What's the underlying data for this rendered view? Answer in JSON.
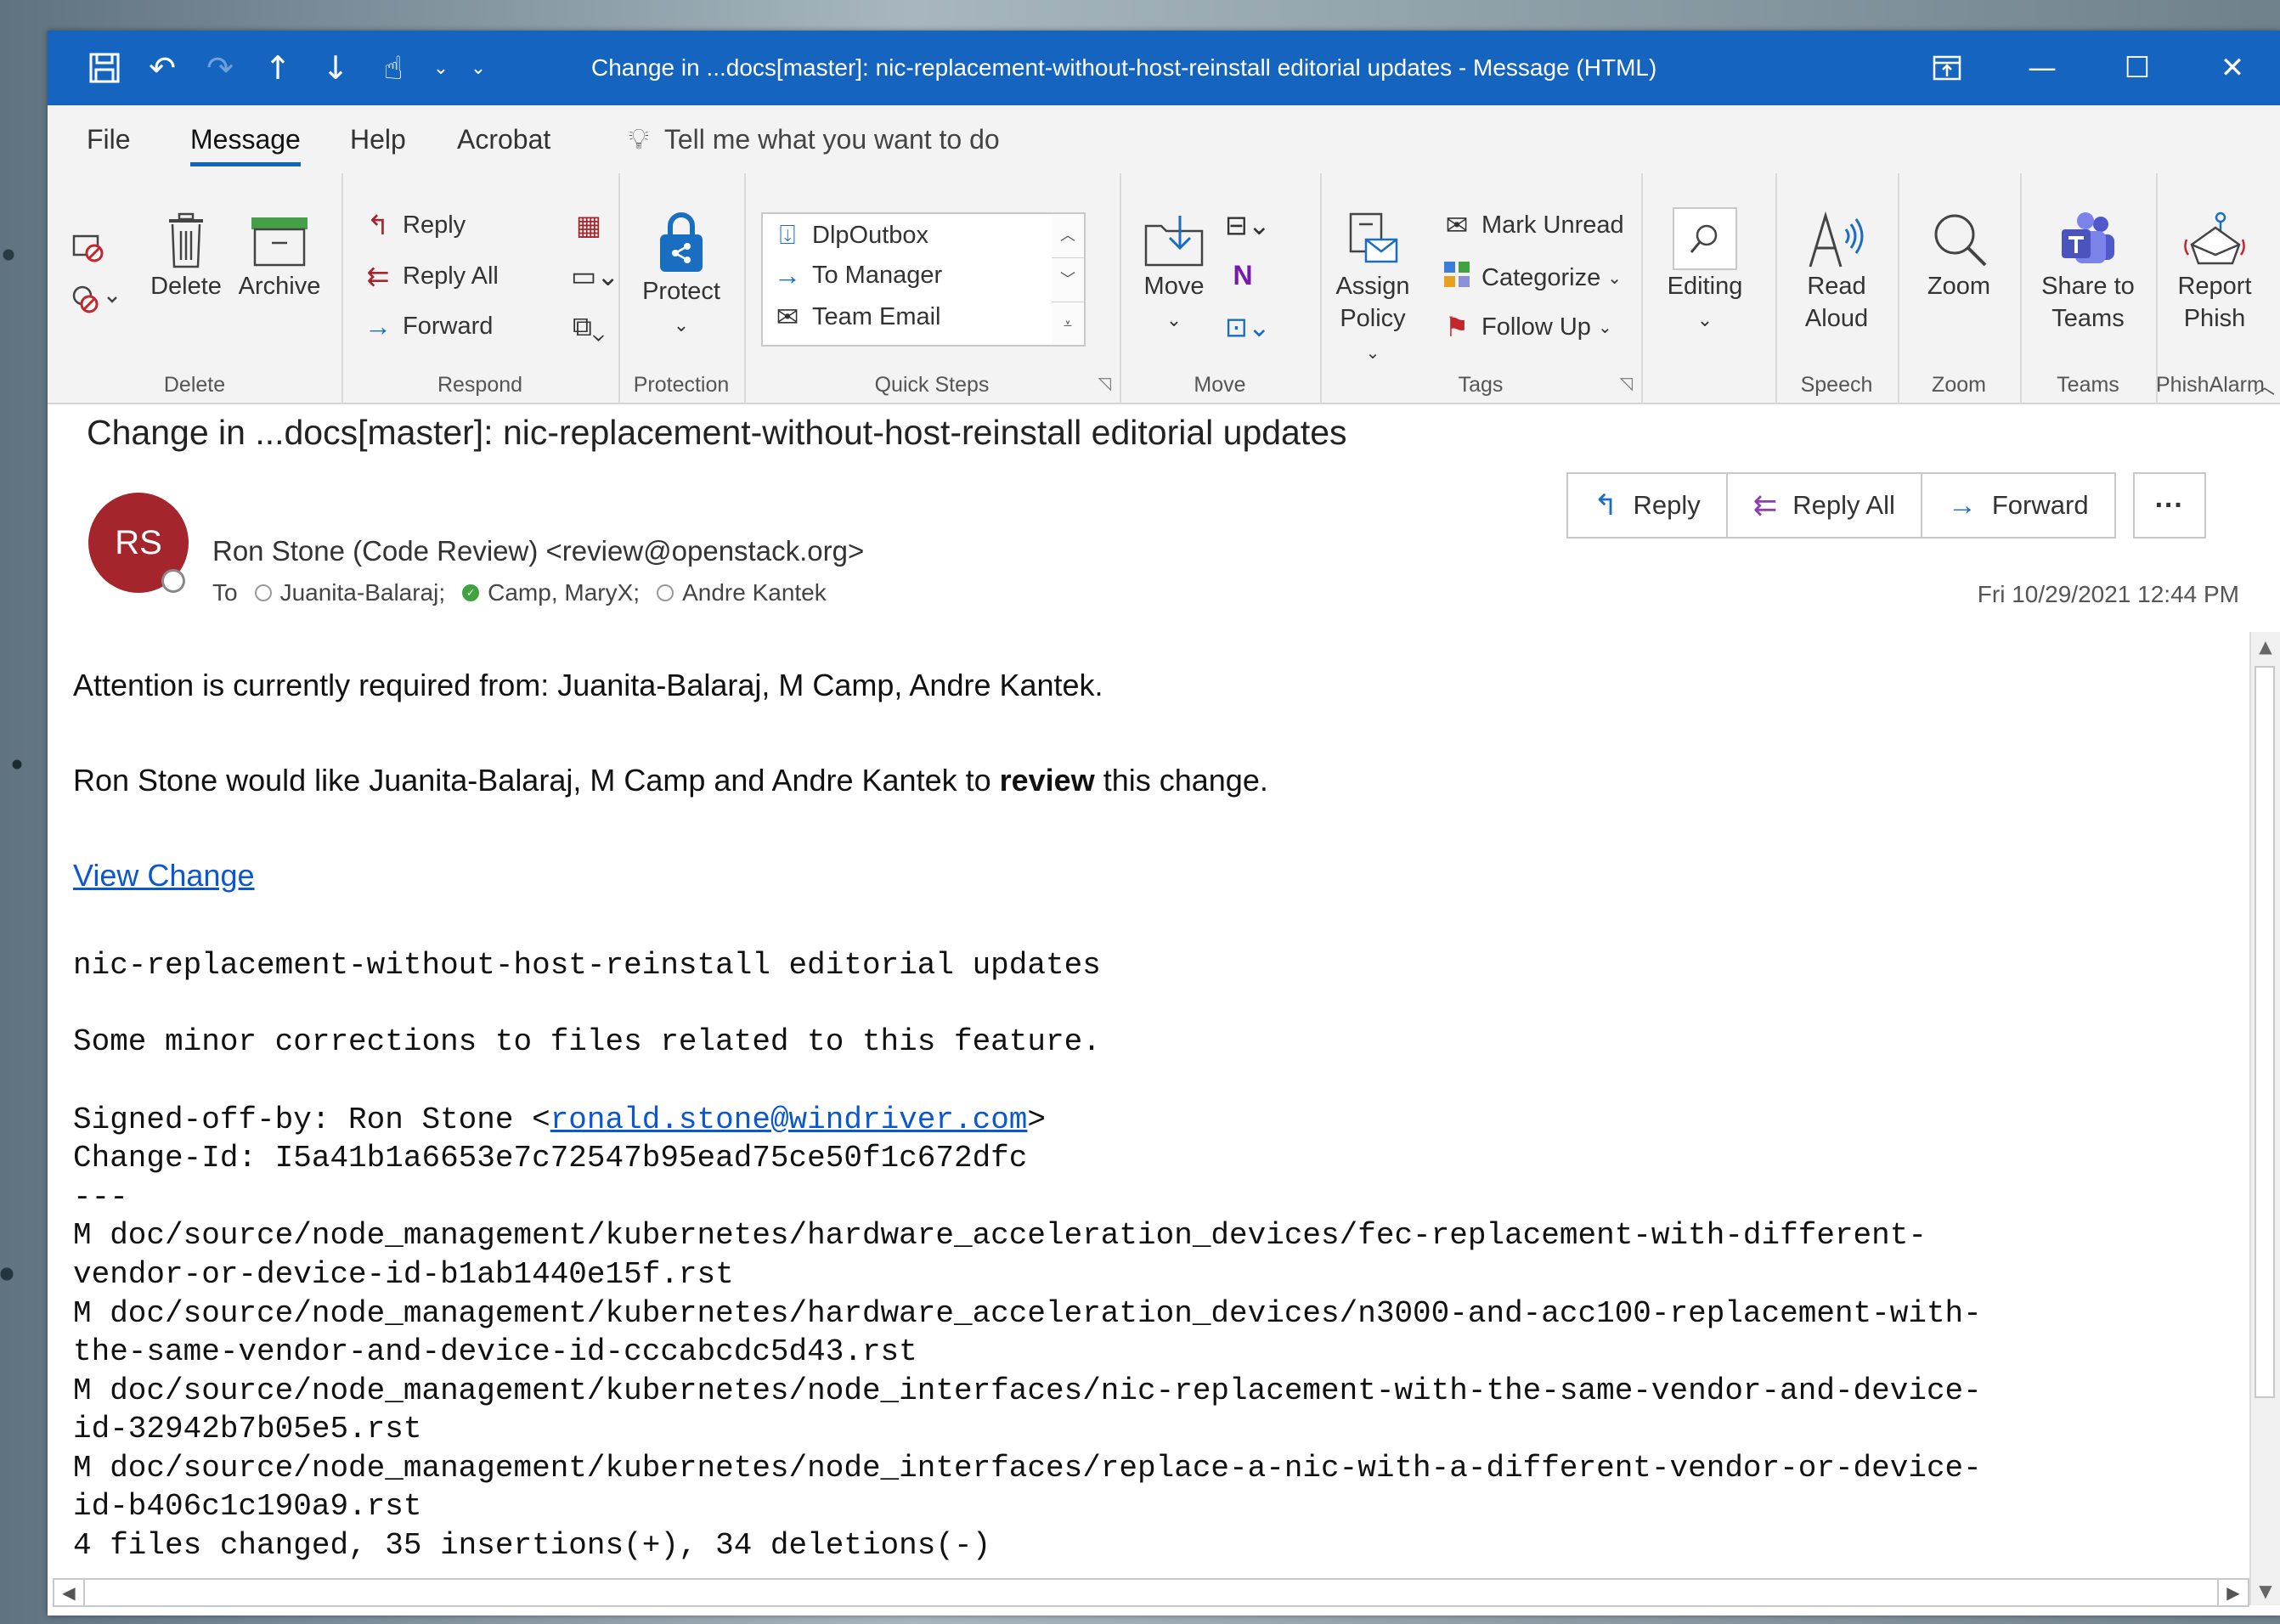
{
  "window": {
    "title": "Change in ...docs[master]: nic-replacement-without-host-reinstall editorial updates  -  Message (HTML)",
    "quick_access_more": "⌄"
  },
  "menu": {
    "tabs": [
      "File",
      "Message",
      "Help",
      "Acrobat"
    ],
    "active": "Message",
    "tell_me": "Tell me what you want to do"
  },
  "ribbon": {
    "delete_group": {
      "label": "Delete",
      "delete": "Delete",
      "archive": "Archive"
    },
    "respond_group": {
      "label": "Respond",
      "reply": "Reply",
      "reply_all": "Reply All",
      "forward": "Forward"
    },
    "protection_group": {
      "label": "Protection",
      "protect": "Protect"
    },
    "quick_steps_group": {
      "label": "Quick Steps",
      "items": [
        "DlpOutbox",
        "To Manager",
        "Team Email"
      ]
    },
    "move_group": {
      "label": "Move",
      "move": "Move"
    },
    "tags_group": {
      "label": "Tags",
      "assign_policy_1": "Assign",
      "assign_policy_2": "Policy",
      "mark_unread": "Mark Unread",
      "categorize": "Categorize",
      "follow_up": "Follow Up"
    },
    "editing": {
      "label": "Editing"
    },
    "speech_group": {
      "label": "Speech",
      "read_aloud_1": "Read",
      "read_aloud_2": "Aloud"
    },
    "zoom_group": {
      "label": "Zoom",
      "zoom": "Zoom"
    },
    "teams_group": {
      "label": "Teams",
      "share_1": "Share to",
      "share_2": "Teams"
    },
    "phish_group": {
      "label": "PhishAlarm",
      "report_1": "Report",
      "report_2": "Phish"
    }
  },
  "message": {
    "subject": "Change in ...docs[master]: nic-replacement-without-host-reinstall editorial updates",
    "avatar_initials": "RS",
    "sender": "Ron Stone (Code Review) <review@openstack.org>",
    "to_label": "To",
    "recipients": [
      "Juanita-Balaraj;",
      "Camp, MaryX;",
      "Andre Kantek"
    ],
    "date": "Fri 10/29/2021 12:44 PM",
    "actions": {
      "reply": "Reply",
      "reply_all": "Reply All",
      "forward": "Forward",
      "more": "···"
    }
  },
  "body": {
    "attention": "Attention is currently required from: Juanita-Balaraj, M Camp, Andre Kantek.",
    "review_pre": "Ron Stone would like Juanita-Balaraj, M Camp and Andre Kantek to ",
    "review_bold": "review",
    "review_post": " this change.",
    "view_change": "View Change",
    "commit_title": "nic-replacement-without-host-reinstall editorial updates",
    "commit_desc": "Some minor corrections to files related to this feature.",
    "signed_pre": "Signed-off-by: Ron Stone <",
    "signed_email": "ronald.stone@windriver.com",
    "signed_post": ">",
    "change_id": "Change-Id: I5a41b1a6653e7c72547b95ead75ce50f1c672dfc",
    "separator": "---",
    "files": [
      "M doc/source/node_management/kubernetes/hardware_acceleration_devices/fec-replacement-with-different-",
      "vendor-or-device-id-b1ab1440e15f.rst",
      "M doc/source/node_management/kubernetes/hardware_acceleration_devices/n3000-and-acc100-replacement-with-",
      "the-same-vendor-and-device-id-cccabcdc5d43.rst",
      "M doc/source/node_management/kubernetes/node_interfaces/nic-replacement-with-the-same-vendor-and-device-",
      "id-32942b7b05e5.rst",
      "M doc/source/node_management/kubernetes/node_interfaces/replace-a-nic-with-a-different-vendor-or-device-",
      "id-b406c1c190a9.rst"
    ],
    "summary": "4 files changed, 35 insertions(+), 34 deletions(-)"
  }
}
